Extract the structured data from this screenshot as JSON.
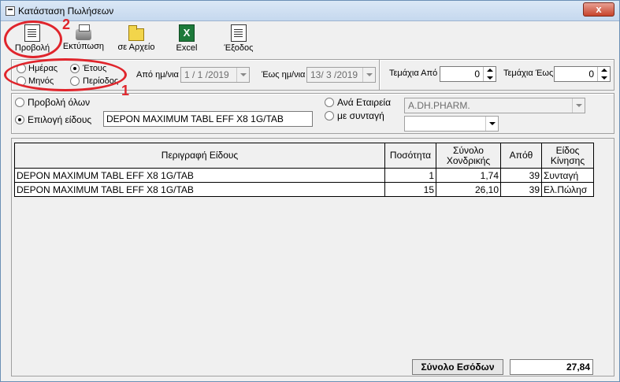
{
  "window": {
    "title": "Κατάσταση Πωλήσεων",
    "close_label": "x"
  },
  "toolbar": {
    "view_label": "Προβολή",
    "print_label": "Εκτύπωση",
    "file_label": "σε Αρχείο",
    "excel_label": "Excel",
    "exit_label": "Έξοδος",
    "excel_glyph": "X"
  },
  "period": {
    "day_label": "Ημέρας",
    "year_label": "Έτους",
    "month_label": "Μηνός",
    "range_label": "Περίοδος",
    "selected": "year"
  },
  "dates": {
    "from_label": "Από ημ/νια",
    "from_value": "1 / 1 /2019",
    "to_label": "Έως ημ/νια",
    "to_value": "13/ 3 /2019"
  },
  "pieces": {
    "from_label": "Τεμάχια Από",
    "from_value": "0",
    "to_label": "Τεμάχια Έως",
    "to_value": "0"
  },
  "filter": {
    "view_all_label": "Προβολή όλων",
    "select_item_label": "Επιλογή είδους",
    "item_value": "DEPON MAXIMUM TABL EFF X8 1G/TAB",
    "by_company_label": "Ανά Εταιρεία",
    "company_value": "A.DH.PHARM.",
    "with_prescription_label": "με συνταγή",
    "prescription_value": ""
  },
  "table": {
    "headers": [
      "Περιγραφή Είδους",
      "Ποσότητα",
      "Σύνολο Χονδρικής",
      "Απόθ",
      "Είδος Κίνησης"
    ],
    "rows": [
      [
        "DEPON MAXIMUM TABL EFF X8 1G/TAB",
        "1",
        "1,74",
        "39",
        "Συνταγή"
      ],
      [
        "DEPON MAXIMUM TABL EFF X8 1G/TAB",
        "15",
        "26,10",
        "39",
        "Ελ.Πώλησ"
      ]
    ]
  },
  "totals": {
    "label": "Σύνολο Εσόδων",
    "value": "27,84"
  },
  "annotations": {
    "mark_1": "1",
    "mark_2": "2",
    "color": "#e0252c"
  }
}
